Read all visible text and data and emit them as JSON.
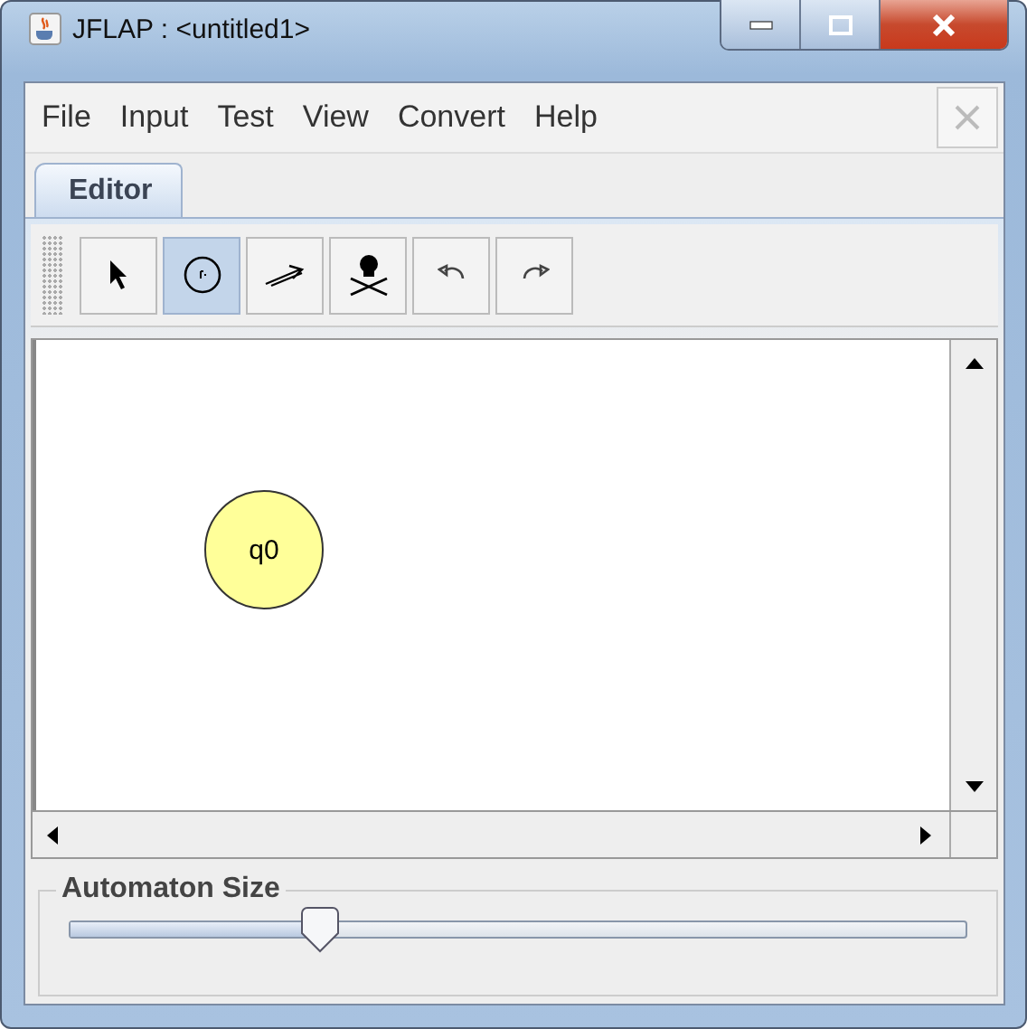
{
  "window": {
    "title": "JFLAP : <untitled1>"
  },
  "menu": [
    "File",
    "Input",
    "Test",
    "View",
    "Convert",
    "Help"
  ],
  "tabs": [
    {
      "label": "Editor",
      "selected": true
    }
  ],
  "tools": [
    {
      "kind": "pointer",
      "selected": false
    },
    {
      "kind": "state",
      "selected": true
    },
    {
      "kind": "transition",
      "selected": false
    },
    {
      "kind": "delete",
      "selected": false
    },
    {
      "kind": "undo",
      "selected": false
    },
    {
      "kind": "redo",
      "selected": false
    }
  ],
  "canvas": {
    "states": [
      {
        "label": "q0"
      }
    ]
  },
  "size_panel": {
    "title": "Automaton Size",
    "level": 0.28
  }
}
